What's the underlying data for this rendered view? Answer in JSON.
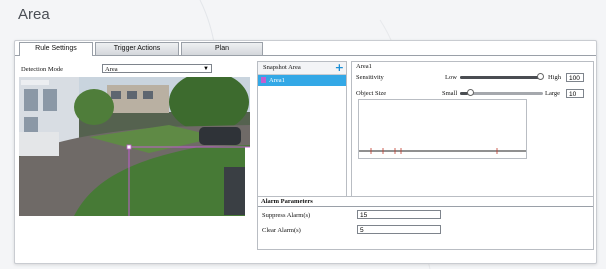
{
  "page": {
    "title": "Area"
  },
  "tabs": [
    {
      "label": "Rule Settings"
    },
    {
      "label": "Trigger Actions"
    },
    {
      "label": "Plan"
    }
  ],
  "detection": {
    "label": "Detection Mode",
    "value": "Area"
  },
  "snapshot": {
    "header": "Snapshot Area",
    "items": [
      {
        "label": "Area1"
      }
    ]
  },
  "area": {
    "title": "Area1",
    "sensitivity": {
      "label": "Sensitivity",
      "low": "Low",
      "high": "High",
      "value": "100",
      "level": 1.0
    },
    "object_size": {
      "label": "Object Size",
      "small": "Small",
      "large": "Large",
      "value": "10",
      "level": 0.1
    }
  },
  "alarm": {
    "title": "Alarm Parameters",
    "suppress": {
      "label": "Suppress Alarm(s)",
      "value": "15"
    },
    "clear": {
      "label": "Clear Alarm(s)",
      "value": "5"
    }
  },
  "colors": {
    "accent": "#33a8e6",
    "region": "#c25fd0",
    "add_icon": "#1a8fd6"
  }
}
